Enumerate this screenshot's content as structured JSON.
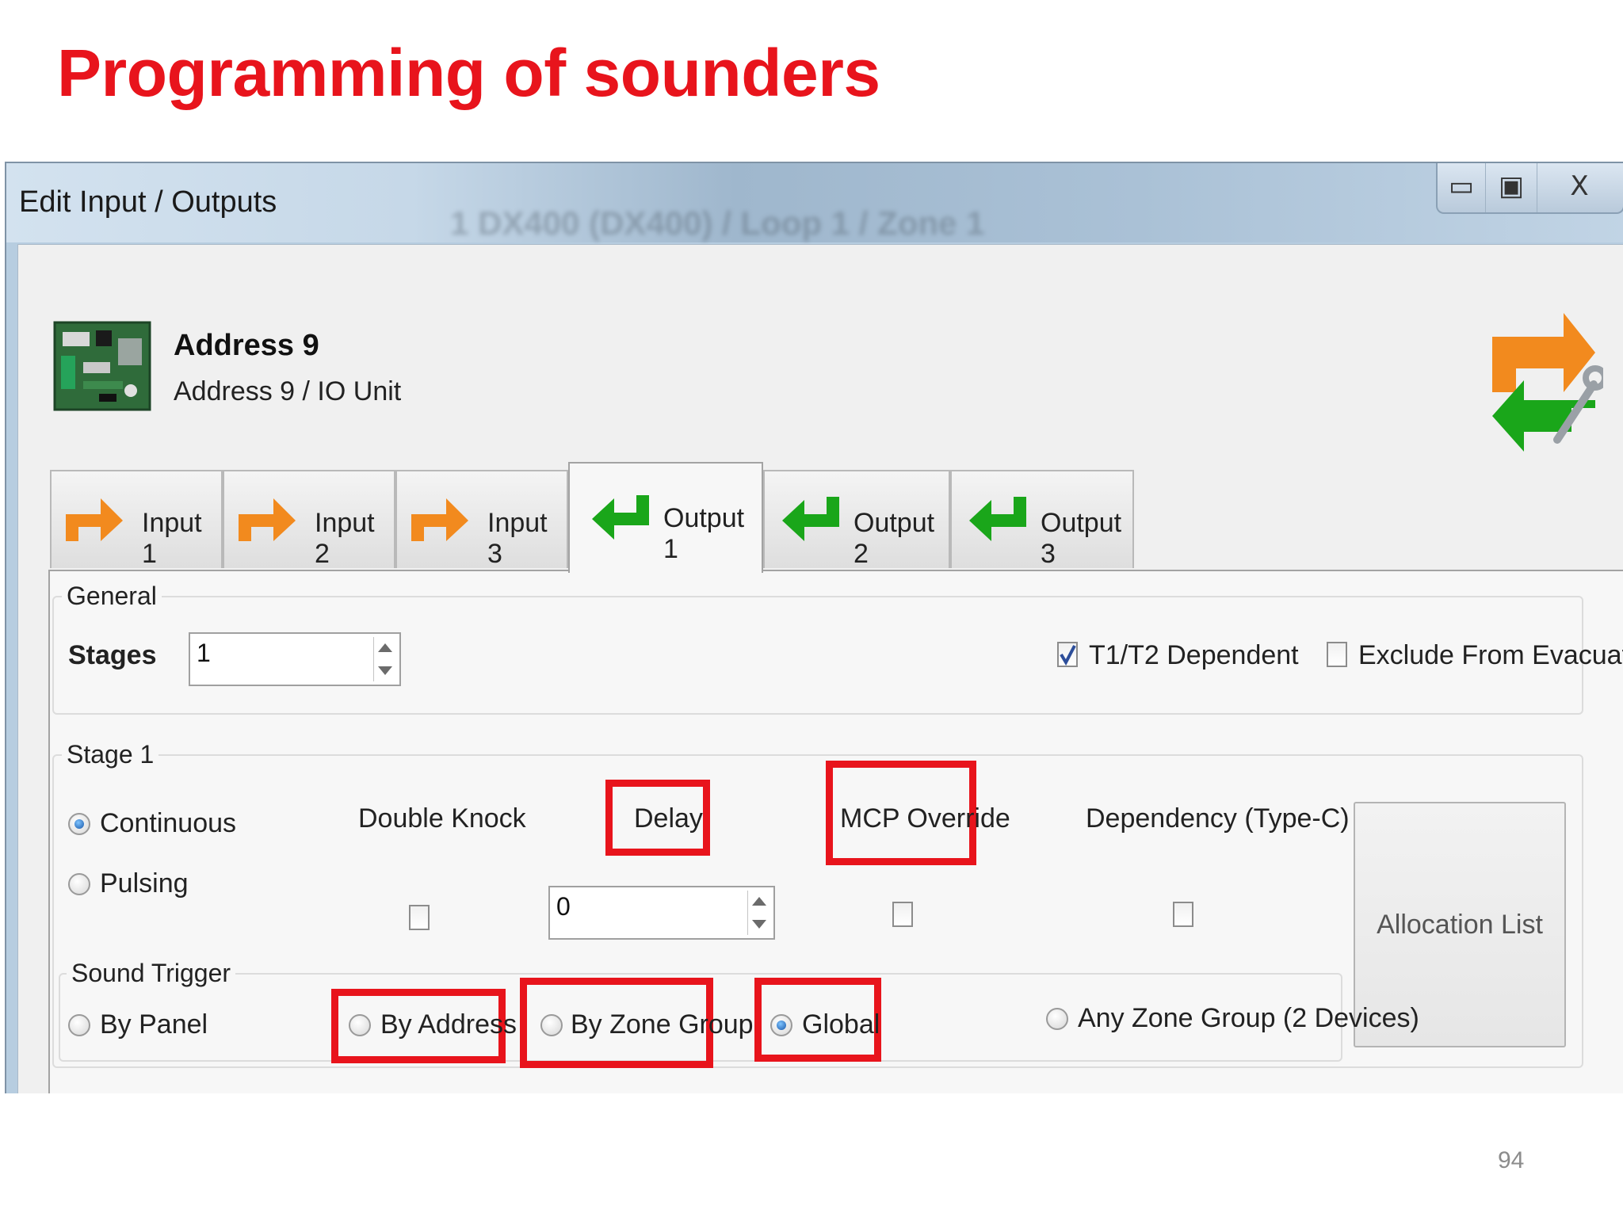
{
  "slide": {
    "title": "Programming of sounders",
    "page_number": "94"
  },
  "window": {
    "title": "Edit Input / Outputs",
    "background_title": "1 DX400 (DX400) / Loop 1 / Zone 1",
    "minimize": "▭",
    "maximize": "▣",
    "close": "X"
  },
  "device": {
    "name": "Address 9",
    "subtitle": "Address 9 / IO Unit"
  },
  "tabs": [
    {
      "label": "Input 1",
      "icon": "orange-arrow-right-icon"
    },
    {
      "label": "Input 2",
      "icon": "orange-arrow-right-icon"
    },
    {
      "label": "Input 3",
      "icon": "orange-arrow-right-icon"
    },
    {
      "label": "Output 1",
      "icon": "green-arrow-left-icon",
      "selected": true
    },
    {
      "label": "Output 2",
      "icon": "green-arrow-left-icon"
    },
    {
      "label": "Output 3",
      "icon": "green-arrow-left-icon"
    }
  ],
  "general": {
    "title": "General",
    "stages_label": "Stages",
    "stages_value": "1",
    "t1t2_label": "T1/T2 Dependent",
    "t1t2_checked": true,
    "exclude_label": "Exclude From Evacuate",
    "exclude_checked": false
  },
  "stage1": {
    "title": "Stage 1",
    "continuous_label": "Continuous",
    "pulsing_label": "Pulsing",
    "mode_selected": "Continuous",
    "double_knock_label": "Double Knock",
    "delay_label": "Delay",
    "delay_value": "0",
    "mcp_override_label": "MCP Override",
    "dependency_label": "Dependency (Type-C)",
    "allocation_label": "Allocation List"
  },
  "sound_trigger": {
    "title": "Sound Trigger",
    "by_panel": "By Panel",
    "by_address": "By Address",
    "by_zone_group": "By Zone Group",
    "global": "Global",
    "any_zone_group": "Any Zone Group (2 Devices)",
    "selected": "Global"
  },
  "colors": {
    "highlight_red": "#e8141c",
    "arrow_orange": "#f28a1e",
    "arrow_green": "#1aa61a"
  }
}
